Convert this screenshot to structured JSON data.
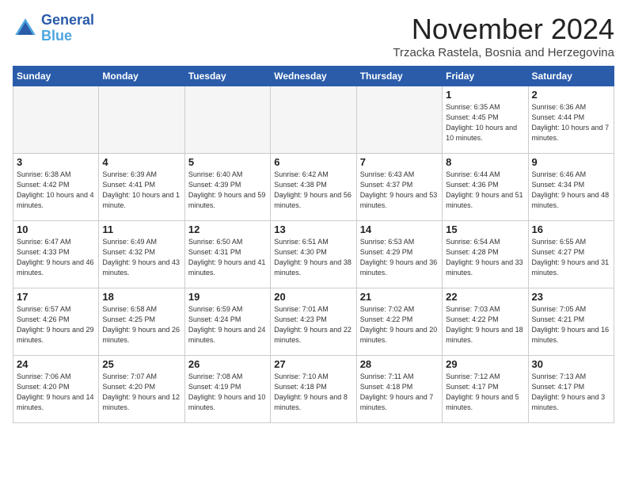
{
  "header": {
    "logo_line1": "General",
    "logo_line2": "Blue",
    "month": "November 2024",
    "location": "Trzacka Rastela, Bosnia and Herzegovina"
  },
  "weekdays": [
    "Sunday",
    "Monday",
    "Tuesday",
    "Wednesday",
    "Thursday",
    "Friday",
    "Saturday"
  ],
  "weeks": [
    [
      {
        "day": "",
        "info": ""
      },
      {
        "day": "",
        "info": ""
      },
      {
        "day": "",
        "info": ""
      },
      {
        "day": "",
        "info": ""
      },
      {
        "day": "",
        "info": ""
      },
      {
        "day": "1",
        "info": "Sunrise: 6:35 AM\nSunset: 4:45 PM\nDaylight: 10 hours\nand 10 minutes."
      },
      {
        "day": "2",
        "info": "Sunrise: 6:36 AM\nSunset: 4:44 PM\nDaylight: 10 hours\nand 7 minutes."
      }
    ],
    [
      {
        "day": "3",
        "info": "Sunrise: 6:38 AM\nSunset: 4:42 PM\nDaylight: 10 hours\nand 4 minutes."
      },
      {
        "day": "4",
        "info": "Sunrise: 6:39 AM\nSunset: 4:41 PM\nDaylight: 10 hours\nand 1 minute."
      },
      {
        "day": "5",
        "info": "Sunrise: 6:40 AM\nSunset: 4:39 PM\nDaylight: 9 hours\nand 59 minutes."
      },
      {
        "day": "6",
        "info": "Sunrise: 6:42 AM\nSunset: 4:38 PM\nDaylight: 9 hours\nand 56 minutes."
      },
      {
        "day": "7",
        "info": "Sunrise: 6:43 AM\nSunset: 4:37 PM\nDaylight: 9 hours\nand 53 minutes."
      },
      {
        "day": "8",
        "info": "Sunrise: 6:44 AM\nSunset: 4:36 PM\nDaylight: 9 hours\nand 51 minutes."
      },
      {
        "day": "9",
        "info": "Sunrise: 6:46 AM\nSunset: 4:34 PM\nDaylight: 9 hours\nand 48 minutes."
      }
    ],
    [
      {
        "day": "10",
        "info": "Sunrise: 6:47 AM\nSunset: 4:33 PM\nDaylight: 9 hours\nand 46 minutes."
      },
      {
        "day": "11",
        "info": "Sunrise: 6:49 AM\nSunset: 4:32 PM\nDaylight: 9 hours\nand 43 minutes."
      },
      {
        "day": "12",
        "info": "Sunrise: 6:50 AM\nSunset: 4:31 PM\nDaylight: 9 hours\nand 41 minutes."
      },
      {
        "day": "13",
        "info": "Sunrise: 6:51 AM\nSunset: 4:30 PM\nDaylight: 9 hours\nand 38 minutes."
      },
      {
        "day": "14",
        "info": "Sunrise: 6:53 AM\nSunset: 4:29 PM\nDaylight: 9 hours\nand 36 minutes."
      },
      {
        "day": "15",
        "info": "Sunrise: 6:54 AM\nSunset: 4:28 PM\nDaylight: 9 hours\nand 33 minutes."
      },
      {
        "day": "16",
        "info": "Sunrise: 6:55 AM\nSunset: 4:27 PM\nDaylight: 9 hours\nand 31 minutes."
      }
    ],
    [
      {
        "day": "17",
        "info": "Sunrise: 6:57 AM\nSunset: 4:26 PM\nDaylight: 9 hours\nand 29 minutes."
      },
      {
        "day": "18",
        "info": "Sunrise: 6:58 AM\nSunset: 4:25 PM\nDaylight: 9 hours\nand 26 minutes."
      },
      {
        "day": "19",
        "info": "Sunrise: 6:59 AM\nSunset: 4:24 PM\nDaylight: 9 hours\nand 24 minutes."
      },
      {
        "day": "20",
        "info": "Sunrise: 7:01 AM\nSunset: 4:23 PM\nDaylight: 9 hours\nand 22 minutes."
      },
      {
        "day": "21",
        "info": "Sunrise: 7:02 AM\nSunset: 4:22 PM\nDaylight: 9 hours\nand 20 minutes."
      },
      {
        "day": "22",
        "info": "Sunrise: 7:03 AM\nSunset: 4:22 PM\nDaylight: 9 hours\nand 18 minutes."
      },
      {
        "day": "23",
        "info": "Sunrise: 7:05 AM\nSunset: 4:21 PM\nDaylight: 9 hours\nand 16 minutes."
      }
    ],
    [
      {
        "day": "24",
        "info": "Sunrise: 7:06 AM\nSunset: 4:20 PM\nDaylight: 9 hours\nand 14 minutes."
      },
      {
        "day": "25",
        "info": "Sunrise: 7:07 AM\nSunset: 4:20 PM\nDaylight: 9 hours\nand 12 minutes."
      },
      {
        "day": "26",
        "info": "Sunrise: 7:08 AM\nSunset: 4:19 PM\nDaylight: 9 hours\nand 10 minutes."
      },
      {
        "day": "27",
        "info": "Sunrise: 7:10 AM\nSunset: 4:18 PM\nDaylight: 9 hours\nand 8 minutes."
      },
      {
        "day": "28",
        "info": "Sunrise: 7:11 AM\nSunset: 4:18 PM\nDaylight: 9 hours\nand 7 minutes."
      },
      {
        "day": "29",
        "info": "Sunrise: 7:12 AM\nSunset: 4:17 PM\nDaylight: 9 hours\nand 5 minutes."
      },
      {
        "day": "30",
        "info": "Sunrise: 7:13 AM\nSunset: 4:17 PM\nDaylight: 9 hours\nand 3 minutes."
      }
    ]
  ]
}
